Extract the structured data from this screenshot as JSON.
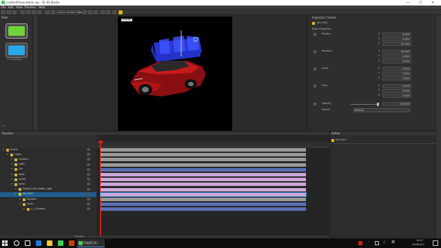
{
  "window": {
    "title": "contentPresentation.uip - Qt 3D Studio",
    "minimize": "—",
    "maximize": "☐",
    "close": "✕"
  },
  "menu": [
    "File",
    "Edit",
    "View",
    "Timeline",
    "Help"
  ],
  "toolbar": {
    "camera_combo": "Scene Camera View"
  },
  "slide_panel": {
    "title": "Slide",
    "slides": [
      {
        "label": "",
        "color": "#6fd33a"
      },
      {
        "label": "+1 candidates",
        "color": "#2aa7e6"
      }
    ],
    "footer": "+1"
  },
  "viewport": {
    "scene_label": "Preview"
  },
  "inspector": {
    "title": "Inspector Control",
    "object_name": "Kia K900",
    "section": "Basic Properties",
    "properties": [
      {
        "label": "Position",
        "x": "0.000",
        "y": "0.000",
        "z": "10.000"
      },
      {
        "label": "Rotation",
        "x": "90.000",
        "y": "0.000",
        "z": "0.000"
      },
      {
        "label": "Scale",
        "x": "1.000",
        "y": "1.000",
        "z": "1.000"
      },
      {
        "label": "Pivot",
        "x": "0.000",
        "y": "0.000",
        "z": "0.000"
      }
    ],
    "opacity_label": "Opacity",
    "opacity_value": "100.000",
    "import_label": "Import",
    "import_value": "[None]"
  },
  "timeline": {
    "title": "Timeline",
    "current_time": "0:00.000",
    "rows": [
      {
        "label": "Scene",
        "indent": 0,
        "color": "#9a9a9a"
      },
      {
        "label": "Layer",
        "indent": 1,
        "color": "#9a9a9a"
      },
      {
        "label": "Camera",
        "indent": 2,
        "color": "#9a9a9a"
      },
      {
        "label": "Light",
        "indent": 2,
        "color": "#9a9a9a"
      },
      {
        "label": "Car",
        "indent": 2,
        "color": "#5b6fb5"
      },
      {
        "label": "body",
        "indent": 2,
        "color": "#c8a6d8"
      },
      {
        "label": "wheel",
        "indent": 2,
        "color": "#c8a6d8"
      },
      {
        "label": "mesh",
        "indent": 2,
        "color": "#c8a6d8"
      },
      {
        "label": "Default_Kia_Model_Light",
        "indent": 3,
        "color": "#c8a6d8"
      },
      {
        "label": "Kia K900",
        "indent": 3,
        "color": "#c8a6d8",
        "selected": true
      },
      {
        "label": "Rotation",
        "indent": 4,
        "color": "#9a9a9a"
      },
      {
        "label": "mesh",
        "indent": 4,
        "color": "#5b6fb5"
      },
      {
        "label": "x_1_Default",
        "indent": 5,
        "color": "#5b6fb5"
      }
    ]
  },
  "action": {
    "title": "Action",
    "object_name": "Kia K900"
  },
  "taskbar": {
    "app_label": "FS应用 (5:)",
    "time": "14:57",
    "date": "2018/1/11",
    "lang": "英"
  }
}
